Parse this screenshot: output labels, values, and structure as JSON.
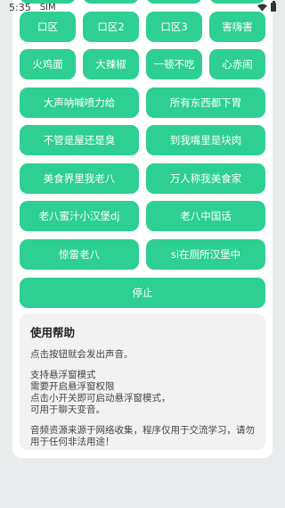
{
  "status_bar": {
    "time": "5:35",
    "sim_label": "SIM"
  },
  "grid4_row_top": [
    "",
    "",
    "",
    ""
  ],
  "grid4_row1": [
    "口区",
    "口区2",
    "口区3",
    "害嗨害"
  ],
  "grid4_row2": [
    "火鸡面",
    "大辣椒",
    "一顿不吃",
    "心赤闹"
  ],
  "grid2_rows": [
    [
      "大声呐喊喷力给",
      "所有东西都下胃"
    ],
    [
      "不管是屋还是臭",
      "到我嘴里是块肉"
    ],
    [
      "美食界里我老八",
      "万人称我美食家"
    ],
    [
      "老八蜜汁小汉堡dj",
      "老八中国话"
    ],
    [
      "惊雷老八",
      "si在厕所汉堡中"
    ]
  ],
  "stop_button": "停止",
  "help": {
    "title": "使用帮助",
    "p1": "点击按钮就会发出声音。",
    "p2": [
      "支持悬浮窗模式",
      "需要开启悬浮窗权限",
      "点击小开关即可启动悬浮窗模式，",
      "可用于聊天变音。"
    ],
    "p3": [
      "音频资源来源于网络收集，程序仅用于交流学习，请勿",
      "用于任何非法用途！"
    ]
  },
  "colors": {
    "accent": "#2dcf92",
    "background": "#e9ecec",
    "card": "#ffffff",
    "help_bg": "#f2f2f2"
  }
}
